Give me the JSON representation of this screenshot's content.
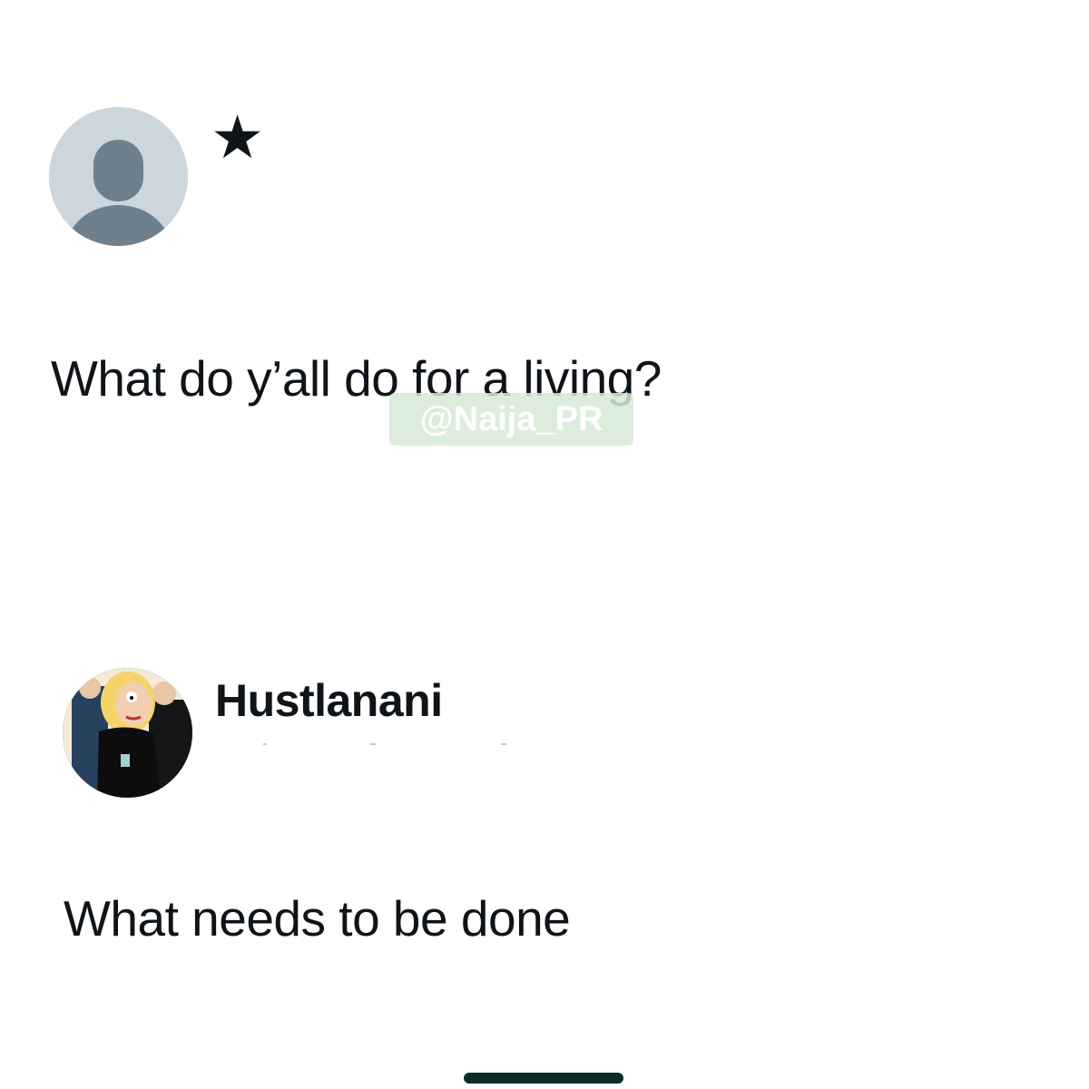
{
  "post1": {
    "avatar_icon": "default-profile-icon",
    "badge_icon": "star-icon",
    "badge_glyph": "★",
    "text": "What do y’all do for a living?"
  },
  "watermark": {
    "text": "@Naija_PR"
  },
  "post2": {
    "avatar_icon": "cartoon-profile-picture",
    "username": "Hustlanani",
    "text": "What needs to be done"
  },
  "colors": {
    "text": "#0f1419",
    "default_avatar_bg": "#ccd6dd",
    "default_avatar_fg": "#6e7f8d",
    "home_indicator": "#0d2a2a"
  }
}
